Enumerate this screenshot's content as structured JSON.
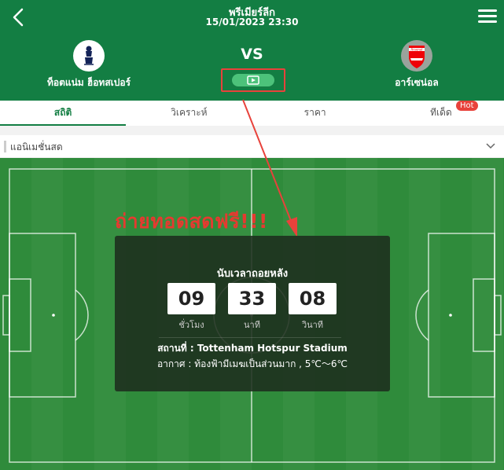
{
  "header": {
    "league": "พรีเมียร์ลีก",
    "datetime": "15/01/2023 23:30",
    "vs": "VS",
    "home_team": {
      "name": "ท็อตแน่ม ฮ็อทสเปอร์",
      "logo_icon": "tottenham-crest-icon"
    },
    "away_team": {
      "name": "อาร์เซน่อล",
      "logo_icon": "arsenal-crest-icon",
      "logo_text": "Arsenal"
    },
    "back_icon": "chevron-left-icon",
    "menu_icon": "hamburger-menu-icon",
    "play_icon": "video-play-icon"
  },
  "tabs": [
    {
      "label": "สถิติ",
      "active": true
    },
    {
      "label": "วิเคราะห์",
      "active": false
    },
    {
      "label": "ราคา",
      "active": false
    },
    {
      "label": "ทีเด็ด",
      "active": false,
      "badge": "Hot"
    }
  ],
  "animation": {
    "label": "แอนิเมชั่นสด",
    "chevron_icon": "chevron-down-icon"
  },
  "promo": {
    "text": "ถ่ายทอดสดฟรี!!!"
  },
  "countdown": {
    "title": "นับเวลาถอยหลัง",
    "hours": "09",
    "minutes": "33",
    "seconds": "08",
    "hours_label": "ชั่วโมง",
    "minutes_label": "นาที",
    "seconds_label": "วินาที",
    "venue": "สถานที่ : Tottenham Hotspur Stadium",
    "weather": "อากาศ : ท้องฟ้ามีเมฆเป็นส่วนมาก , 5℃～6℃"
  },
  "colors": {
    "brand_green": "#137e43",
    "accent_red": "#e8423b",
    "play_green": "#4cc27a",
    "pitch_green": "#2f8b3b"
  }
}
